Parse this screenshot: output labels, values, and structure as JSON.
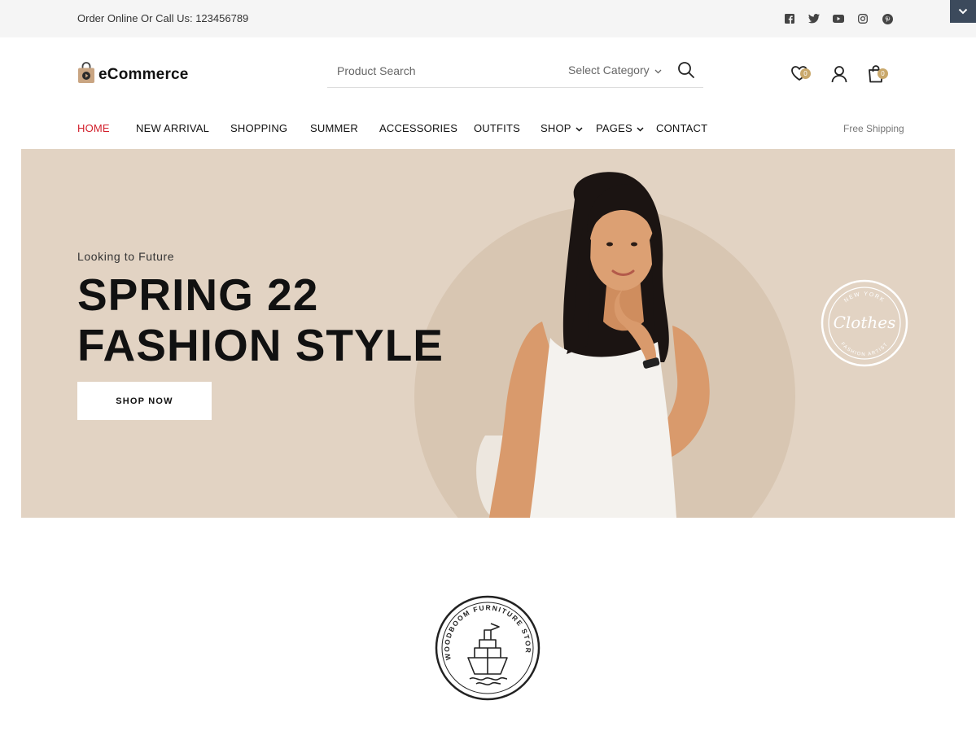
{
  "topbar": {
    "contact_text": "Order Online Or Call Us: 123456789",
    "social_icons": [
      "facebook-icon",
      "twitter-icon",
      "youtube-icon",
      "instagram-icon",
      "pinterest-icon"
    ]
  },
  "header": {
    "logo_text": "eCommerce",
    "search": {
      "placeholder": "Product Search",
      "category_label": "Select Category"
    },
    "wishlist_count": "0",
    "cart_count": "0"
  },
  "nav": {
    "items": [
      {
        "label": "HOME",
        "active": true
      },
      {
        "label": "NEW ARRIVAL"
      },
      {
        "label": "SHOPPING"
      },
      {
        "label": "SUMMER"
      },
      {
        "label": "ACCESSORIES"
      },
      {
        "label": "OUTFITS"
      },
      {
        "label": "SHOP"
      },
      {
        "label": "PAGES"
      },
      {
        "label": "CONTACT"
      }
    ],
    "free_shipping": "Free Shipping"
  },
  "hero": {
    "eyebrow": "Looking to Future",
    "title_line1": "SPRING 22",
    "title_line2": "FASHION STYLE",
    "button_label": "SHOP NOW",
    "stamp_text_top": "NEW YORK",
    "stamp_script": "Clothes",
    "stamp_text_bottom": "FASHION ARTIST"
  },
  "brand": {
    "name": "WOODBOOM FURNITURE STORE"
  },
  "colors": {
    "accent": "#d21f2b",
    "hero_bg": "#e2d3c3",
    "badge": "#c9a86b",
    "topbar_bg": "#f5f5f5",
    "collapse_btn": "#3c4a5c"
  }
}
